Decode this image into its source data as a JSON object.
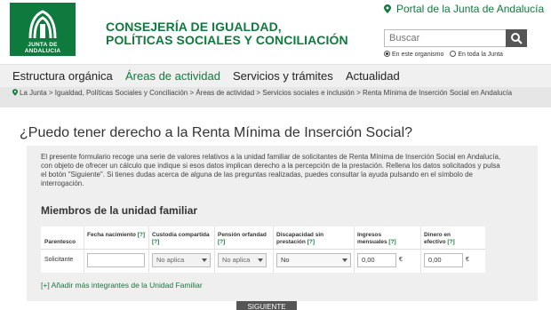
{
  "header": {
    "logo_text": "JUNTA DE ANDALUCIA",
    "consejeria_line1": "CONSEJERÍA DE IGUALDAD,",
    "consejeria_line2": "POLÍTICAS SOCIALES Y CONCILIACIÓN",
    "portal_link": "Portal de la Junta de Andalucía",
    "search_placeholder": "Buscar",
    "radio_option_1": "En este organismo",
    "radio_option_2": "En toda la Junta",
    "radio_selected": "En este organismo"
  },
  "nav": {
    "items": [
      {
        "label": "Estructura orgánica",
        "active": false
      },
      {
        "label": "Áreas de actividad",
        "active": true
      },
      {
        "label": "Servicios y trámites",
        "active": false
      },
      {
        "label": "Actualidad",
        "active": false
      }
    ]
  },
  "breadcrumb": {
    "text": "La Junta > Igualdad, Políticas Sociales y Conciliación > Áreas de actividad > Servicios sociales e inclusión > Renta Mínima de Inserción Social en Andalucía"
  },
  "main": {
    "title": "¿Puedo tener derecho a la Renta Mínima de Inserción Social?",
    "intro": "El presente formulario recoge una serie de valores relativos a la unidad familiar de solicitantes de Renta Mínima de Inserción Social en Andalucía, con objeto de ofrecer un cálculo que indique si esos datos implican derecho a la percepción de la prestación. Rellena los datos solicitados y pulsa el botón \"Siguiente\". Si tienes dudas acerca de alguna de las preguntas realizadas, puedes consultar la ayuda pulsando en el símbolo de interrogación.",
    "members_title": "Miembros de la unidad familiar",
    "table": {
      "headers": {
        "parentesco": "Parentesco",
        "fecha_nacimiento": "Fecha nacimiento",
        "custodia": "Custodia compartida",
        "pension": "Pensión orfandad",
        "discapacidad": "Discapacidad sin prestación",
        "ingresos": "Ingresos mensuales",
        "dinero": "Dinero en efectivo"
      },
      "help_marker": "[?]",
      "row": {
        "parentesco": "Solicitante",
        "fecha_nacimiento": "",
        "custodia": "No aplica",
        "pension": "No aplica",
        "discapacidad": "No",
        "ingresos": "0,00",
        "dinero": "0,00",
        "currency": "€"
      }
    },
    "add_more": "[+] Añadir más integrantes de la Unidad Familiar",
    "next_button": "SIGUIENTE"
  },
  "colors": {
    "brand_green": "#0f7a3d",
    "nav_bg": "#f0f0f0",
    "breadcrumb_bg": "#e6e6e6",
    "panel_bg": "#efefef",
    "button_dark": "#555555"
  }
}
